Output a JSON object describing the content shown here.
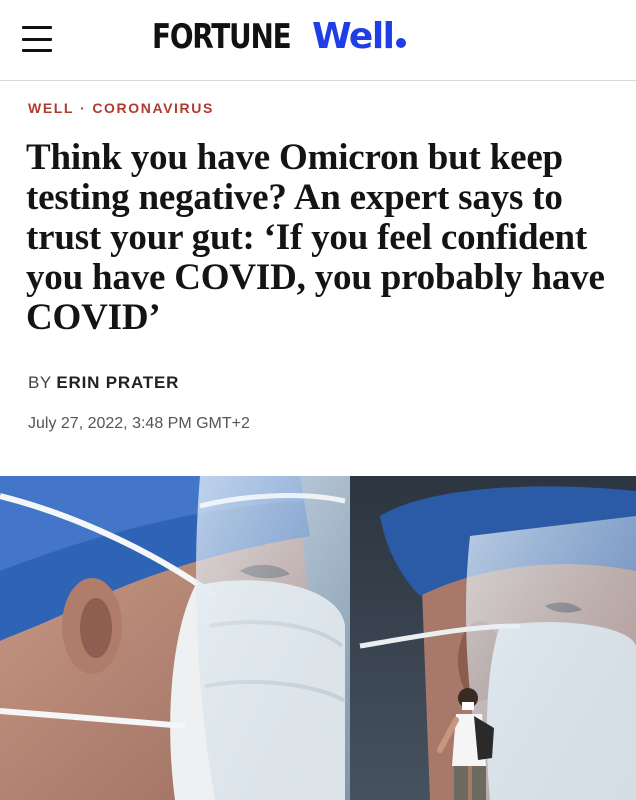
{
  "header": {
    "menu_icon": "hamburger-menu-icon",
    "brand": "FORTUNE",
    "brand_section": "Well",
    "brand_color": "#1f3ee6"
  },
  "article": {
    "breadcrumb": {
      "section": "WELL",
      "separator": "·",
      "topic": "CORONAVIRUS"
    },
    "headline": "Think you have Omicron but keep testing negative? An expert says to trust your gut: ‘If you feel confident you have COVID, you probably have COVID’",
    "byline_prefix": "BY",
    "author": "ERIN PRATER",
    "date": "July 27, 2022, 3:48 PM GMT+2"
  },
  "colors": {
    "breadcrumb": "#b03a2e",
    "text": "#141414"
  }
}
